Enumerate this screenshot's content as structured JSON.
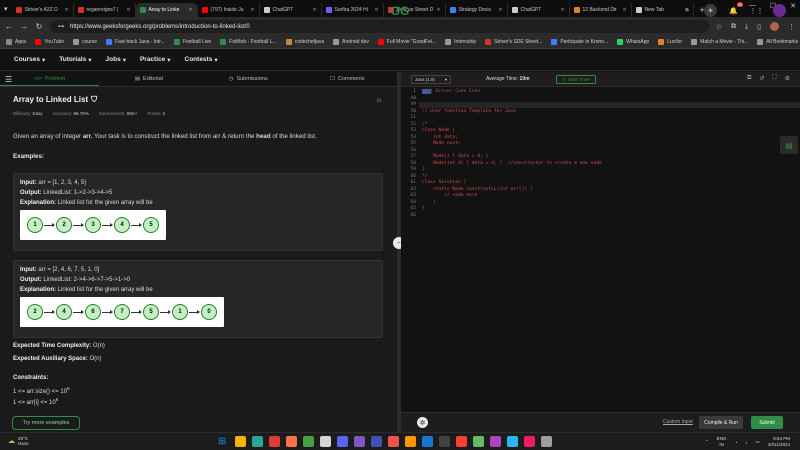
{
  "browser": {
    "tabs": [
      {
        "label": "Striver's A2Z D",
        "color": "#d93025"
      },
      {
        "label": "reganreigns7 |",
        "color": "#d93025"
      },
      {
        "label": "Array to Linke",
        "color": "#2f8d46",
        "active": true
      },
      {
        "label": "(797) Inside Ju",
        "color": "#ff0000"
      },
      {
        "label": "ChatGPT",
        "color": "#cccccc"
      },
      {
        "label": "Sarfira 2024 Hi",
        "color": "#7a5af8"
      },
      {
        "label": "Rescue Street D",
        "color": "#d93025"
      },
      {
        "label": "Strategy Decis",
        "color": "#3b82f6"
      },
      {
        "label": "ChatGPT",
        "color": "#cccccc"
      },
      {
        "label": "12 Backend Dir",
        "color": "#e67e22"
      },
      {
        "label": "New Tab",
        "color": "#cccccc"
      }
    ],
    "url": "https://www.geeksforgeeks.org/problems/introduction-to-linked-list/0",
    "bookmarks": [
      {
        "label": "Apps",
        "color": "#888888"
      },
      {
        "label": "YouTube",
        "color": "#ff0000"
      },
      {
        "label": "course",
        "color": "#999999"
      },
      {
        "label": "Fast-track Java - Intr...",
        "color": "#3b82f6"
      },
      {
        "label": "Football Live",
        "color": "#2f8d46"
      },
      {
        "label": "FotMob - Football L...",
        "color": "#2f8d46"
      },
      {
        "label": "codechefjava",
        "color": "#c08a3e"
      },
      {
        "label": "Android dev",
        "color": "#999999"
      },
      {
        "label": "Full Movie \"GoodFel...",
        "color": "#ff0000"
      },
      {
        "label": "Internship",
        "color": "#999999"
      },
      {
        "label": "Striver's SDE Sheet...",
        "color": "#d93025"
      },
      {
        "label": "Participate in Krono...",
        "color": "#3b82f6"
      },
      {
        "label": "WhatsApp",
        "color": "#25d366"
      },
      {
        "label": "Lucifer",
        "color": "#e67e22"
      },
      {
        "label": "Match a Movie - Thi...",
        "color": "#999999"
      }
    ],
    "all_bookmarks": "All Bookmarks"
  },
  "site": {
    "logo": "GG",
    "menu": [
      "Courses",
      "Tutorials",
      "Jobs",
      "Practice",
      "Contests"
    ],
    "notif_count": "45"
  },
  "left": {
    "tabs": [
      "Problem",
      "Editorial",
      "Submissions",
      "Comments"
    ],
    "title": "Array to Linked List",
    "meta": {
      "difficulty_label": "Difficulty:",
      "difficulty": "Easy",
      "accuracy_label": "Accuracy:",
      "accuracy": "66.76%",
      "submissions_label": "Submissions:",
      "submissions": "55K+",
      "points_label": "Points:",
      "points": "2"
    },
    "desc_pre": "Given an array of integer ",
    "desc_arr": "arr.",
    "desc_mid": " Your task is to construct the linked list from arr & return the ",
    "desc_head": "head",
    "desc_post": " of the linked list.",
    "examples_heading": "Examples:",
    "input_label": "Input:",
    "output_label": "Output:",
    "explanation_label": "Explanation:",
    "examples": [
      {
        "input": "arr = [1, 2, 3, 4, 5]",
        "output": "LinkedList: 1->2->3->4->5",
        "explanation": "Linked list for the given array will be",
        "nodes": [
          "1",
          "2",
          "3",
          "4",
          "5"
        ]
      },
      {
        "input": "arr = [2, 4, 6, 7, 5, 1, 0]",
        "output": "LinkedList: 2->4->6->7->5->1->0",
        "explanation": "Linked list for the given array will be",
        "nodes": [
          "2",
          "4",
          "6",
          "7",
          "5",
          "1",
          "0"
        ]
      }
    ],
    "time_label": "Expected Time Complexity:",
    "time_value": "O(n)",
    "space_label": "Expected Auxiliary Space:",
    "space_value": "O(n)",
    "constraints_heading": "Constraints:",
    "constraints": [
      {
        "text": "1 <= arr.size() <= 10",
        "sup": "6"
      },
      {
        "text": "1 <= arr[i] <= 10",
        "sup": "6"
      }
    ],
    "more_examples": "Try more examples"
  },
  "editor": {
    "language": "Java (1.8)",
    "avg_time_label": "Average Time:",
    "avg_time": "10m",
    "start_timer": "Start Timer",
    "lines": [
      {
        "n": "1",
        "t": "// } Driver Code Ends"
      },
      {
        "n": "48",
        "t": ""
      },
      {
        "n": "49",
        "t": ""
      },
      {
        "n": "50",
        "t": "// User function Template for Java"
      },
      {
        "n": "51",
        "t": ""
      },
      {
        "n": "52",
        "t": "/*"
      },
      {
        "n": "53",
        "t": "class Node {"
      },
      {
        "n": "54",
        "t": "    int data;"
      },
      {
        "n": "55",
        "t": "    Node next;"
      },
      {
        "n": "56",
        "t": ""
      },
      {
        "n": "57",
        "t": "    Node() { data = 0; }"
      },
      {
        "n": "58",
        "t": "    Node(int d) { data = d; }  //constructor to create a new node"
      },
      {
        "n": "59",
        "t": "}"
      },
      {
        "n": "60",
        "t": "*/"
      },
      {
        "n": "61",
        "t": "class Solution {"
      },
      {
        "n": "62",
        "t": "    static Node constructLL(int arr[]) {"
      },
      {
        "n": "63",
        "t": "        // code here"
      },
      {
        "n": "64",
        "t": "    }"
      },
      {
        "n": "65",
        "t": "}"
      },
      {
        "n": "66",
        "t": ""
      }
    ],
    "custom_input": "Custom Input",
    "compile_run": "Compile & Run",
    "submit": "Submit"
  },
  "taskbar": {
    "temp": "25°C",
    "condition": "Haze",
    "lang": "ENG",
    "region": "IN",
    "time": "8:54 PM",
    "date": "10/11/2024",
    "apps": [
      "#1e88e5",
      "#f5b400",
      "#26a69a",
      "#e53935",
      "#ff7043",
      "#43a047",
      "#d4d4d4",
      "#5865f2",
      "#7e57c2",
      "#3f51b5",
      "#ef5350",
      "#ff9800",
      "#1976d2",
      "#424242",
      "#f44336",
      "#66bb6a",
      "#ab47bc",
      "#29b6f6",
      "#e91e63",
      "#9e9e9e"
    ]
  }
}
